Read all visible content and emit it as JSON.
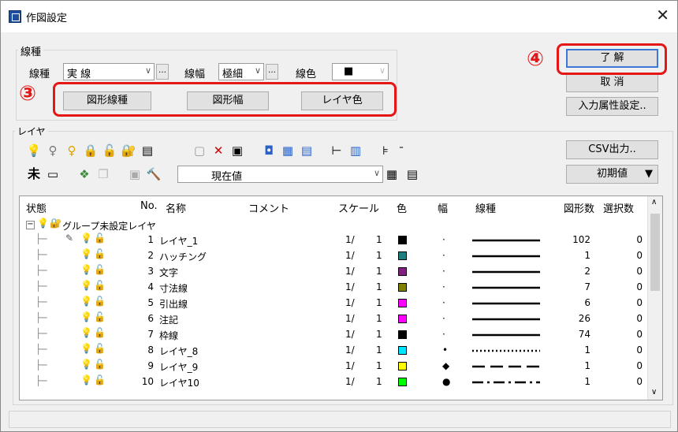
{
  "window": {
    "title": "作図設定"
  },
  "line_type": {
    "group_label": "線種",
    "type_label": "線種",
    "type_value": "実 線",
    "width_label": "線幅",
    "width_value": "極細",
    "color_label": "線色",
    "color_value": "■",
    "shape_linetype_btn": "図形線種",
    "shape_width_btn": "図形幅",
    "layer_color_btn": "レイヤ色"
  },
  "buttons": {
    "ok": "了 解",
    "cancel": "取 消",
    "input_attr": "入力属性設定.."
  },
  "annotations": {
    "circle3": "③",
    "circle4": "④"
  },
  "layer": {
    "group_label": "レイヤ",
    "csv_btn": "CSV出力..",
    "unset_char": "未",
    "current_value": "現在値",
    "initial_value": "初期値",
    "columns": [
      "状態",
      "No.",
      "名称",
      "コメント",
      "スケール",
      "色",
      "幅",
      "線種",
      "図形数",
      "選択数"
    ],
    "group_name": "グループ未設定レイヤ",
    "rows": [
      {
        "no": "1",
        "name": "レイヤ_1",
        "scale_a": "1/",
        "scale_b": "1",
        "color": "#000000",
        "width": "·",
        "line": "solid",
        "shapes": "102",
        "selected": "0"
      },
      {
        "no": "2",
        "name": "ハッチング",
        "scale_a": "1/",
        "scale_b": "1",
        "color": "#1f7f7f",
        "width": "·",
        "line": "solid",
        "shapes": "1",
        "selected": "0"
      },
      {
        "no": "3",
        "name": "文字",
        "scale_a": "1/",
        "scale_b": "1",
        "color": "#7f1f7f",
        "width": "·",
        "line": "solid",
        "shapes": "2",
        "selected": "0"
      },
      {
        "no": "4",
        "name": "寸法線",
        "scale_a": "1/",
        "scale_b": "1",
        "color": "#7f7f00",
        "width": "·",
        "line": "solid",
        "shapes": "7",
        "selected": "0"
      },
      {
        "no": "5",
        "name": "引出線",
        "scale_a": "1/",
        "scale_b": "1",
        "color": "#ff00ff",
        "width": "·",
        "line": "solid",
        "shapes": "6",
        "selected": "0"
      },
      {
        "no": "6",
        "name": "注記",
        "scale_a": "1/",
        "scale_b": "1",
        "color": "#ff00ff",
        "width": "·",
        "line": "solid",
        "shapes": "26",
        "selected": "0"
      },
      {
        "no": "7",
        "name": "枠線",
        "scale_a": "1/",
        "scale_b": "1",
        "color": "#000000",
        "width": "·",
        "line": "solid",
        "shapes": "74",
        "selected": "0"
      },
      {
        "no": "8",
        "name": "レイヤ_8",
        "scale_a": "1/",
        "scale_b": "1",
        "color": "#00e5ff",
        "width": "•",
        "line": "dotted",
        "shapes": "1",
        "selected": "0"
      },
      {
        "no": "9",
        "name": "レイヤ_9",
        "scale_a": "1/",
        "scale_b": "1",
        "color": "#ffff00",
        "width": "◆",
        "line": "dashed",
        "shapes": "1",
        "selected": "0"
      },
      {
        "no": "10",
        "name": "レイヤ10",
        "scale_a": "1/",
        "scale_b": "1",
        "color": "#00ff00",
        "width": "●",
        "line": "dashdot",
        "shapes": "1",
        "selected": "0"
      }
    ]
  }
}
